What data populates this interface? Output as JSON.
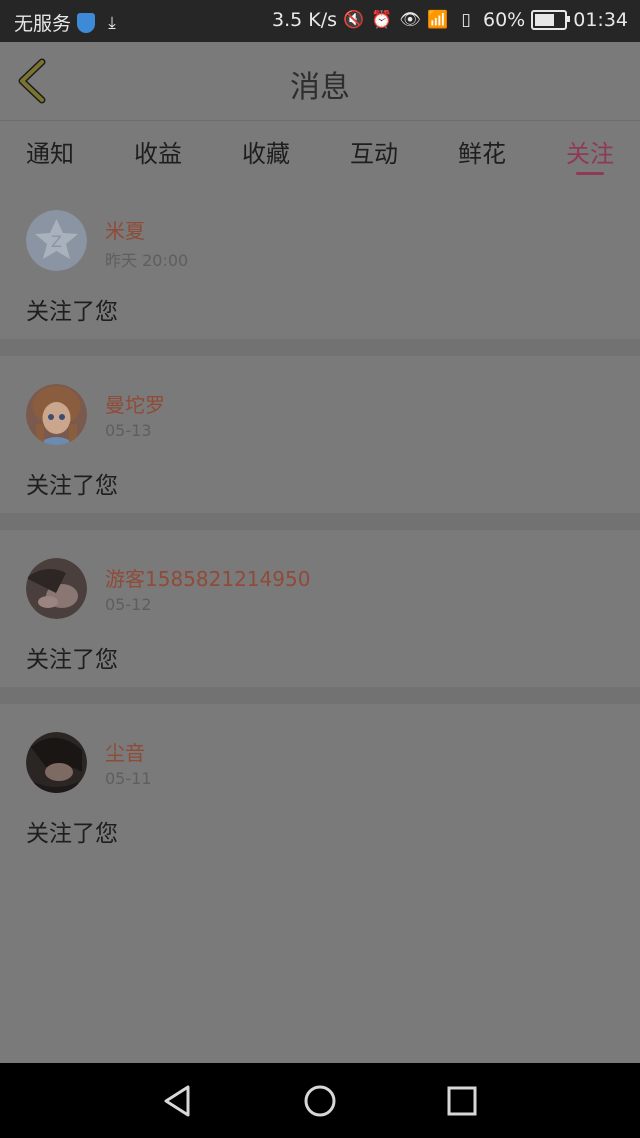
{
  "status_bar": {
    "carrier": "无服务",
    "speed": "3.5 K/s",
    "battery": "60%",
    "time": "01:34",
    "battery_level": 0.6
  },
  "header": {
    "title": "消息"
  },
  "tabs": [
    {
      "label": "通知",
      "active": false
    },
    {
      "label": "收益",
      "active": false
    },
    {
      "label": "收藏",
      "active": false
    },
    {
      "label": "互动",
      "active": false
    },
    {
      "label": "鲜花",
      "active": false
    },
    {
      "label": "关注",
      "active": true
    }
  ],
  "messages": [
    {
      "name": "米夏",
      "time": "昨天 20:00",
      "text": "关注了您",
      "avatar": "default-avatar"
    },
    {
      "name": "曼坨罗",
      "time": "05-13",
      "text": "关注了您",
      "avatar": "anime-avatar"
    },
    {
      "name": "游客1585821214950",
      "time": "05-12",
      "text": "关注了您",
      "avatar": "photo-avatar"
    },
    {
      "name": "尘音",
      "time": "05-11",
      "text": "关注了您",
      "avatar": "photo-avatar"
    }
  ],
  "colors": {
    "accent": "#8e3a55",
    "name": "#8f4b37"
  }
}
